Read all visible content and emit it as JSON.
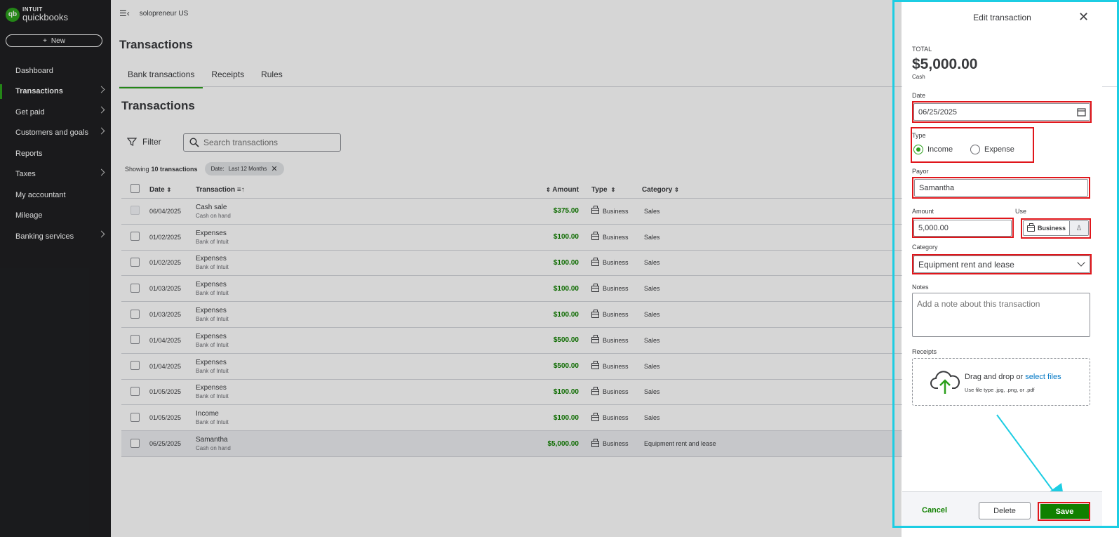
{
  "brand": {
    "mark": "qb",
    "line1": "INTUIT",
    "line2": "quickbooks"
  },
  "sidebar": {
    "new_label": "New",
    "items": [
      {
        "label": "Dashboard"
      },
      {
        "label": "Transactions"
      },
      {
        "label": "Get paid"
      },
      {
        "label": "Customers and goals"
      },
      {
        "label": "Reports"
      },
      {
        "label": "Taxes"
      },
      {
        "label": "My accountant"
      },
      {
        "label": "Mileage"
      },
      {
        "label": "Banking services"
      }
    ]
  },
  "header": {
    "company": "solopreneur US",
    "page_title": "Transactions"
  },
  "tabs": [
    "Bank transactions",
    "Receipts",
    "Rules"
  ],
  "section_title": "Transactions",
  "filter_label": "Filter",
  "search": {
    "placeholder": "Search transactions"
  },
  "showing": {
    "prefix": "Showing",
    "count": "10 transactions",
    "chip_label": "Date:",
    "chip_value": "Last 12 Months"
  },
  "table": {
    "columns": {
      "date": "Date",
      "transaction": "Transaction",
      "amount": "Amount",
      "type": "Type",
      "category": "Category"
    },
    "rows": [
      {
        "date": "06/04/2025",
        "name": "Cash sale",
        "account": "Cash on hand",
        "amount": "$375.00",
        "type": "Business",
        "category": "Sales"
      },
      {
        "date": "01/02/2025",
        "name": "Expenses",
        "account": "Bank of Intuit",
        "amount": "$100.00",
        "type": "Business",
        "category": "Sales"
      },
      {
        "date": "01/02/2025",
        "name": "Expenses",
        "account": "Bank of Intuit",
        "amount": "$100.00",
        "type": "Business",
        "category": "Sales"
      },
      {
        "date": "01/03/2025",
        "name": "Expenses",
        "account": "Bank of Intuit",
        "amount": "$100.00",
        "type": "Business",
        "category": "Sales"
      },
      {
        "date": "01/03/2025",
        "name": "Expenses",
        "account": "Bank of Intuit",
        "amount": "$100.00",
        "type": "Business",
        "category": "Sales"
      },
      {
        "date": "01/04/2025",
        "name": "Expenses",
        "account": "Bank of Intuit",
        "amount": "$500.00",
        "type": "Business",
        "category": "Sales"
      },
      {
        "date": "01/04/2025",
        "name": "Expenses",
        "account": "Bank of Intuit",
        "amount": "$500.00",
        "type": "Business",
        "category": "Sales"
      },
      {
        "date": "01/05/2025",
        "name": "Expenses",
        "account": "Bank of Intuit",
        "amount": "$100.00",
        "type": "Business",
        "category": "Sales"
      },
      {
        "date": "01/05/2025",
        "name": "Income",
        "account": "Bank of Intuit",
        "amount": "$100.00",
        "type": "Business",
        "category": "Sales"
      },
      {
        "date": "06/25/2025",
        "name": "Samantha",
        "account": "Cash on hand",
        "amount": "$5,000.00",
        "type": "Business",
        "category": "Equipment rent and lease"
      }
    ]
  },
  "drawer": {
    "title": "Edit transaction",
    "total_label": "TOTAL",
    "total_value": "$5,000.00",
    "total_account": "Cash",
    "date_label": "Date",
    "date_value": "06/25/2025",
    "type_label": "Type",
    "type_income": "Income",
    "type_expense": "Expense",
    "payor_label": "Payor",
    "payor_value": "Samantha",
    "amount_label": "Amount",
    "amount_value": "5,000.00",
    "use_label": "Use",
    "use_value": "Business",
    "category_label": "Category",
    "category_value": "Equipment rent and lease",
    "notes_label": "Notes",
    "notes_placeholder": "Add a note about this transaction",
    "receipts_label": "Receipts",
    "upload_text": "Drag and drop or",
    "upload_link": "select files",
    "upload_hint": "Use file type .jpg, .png, or .pdf",
    "cancel": "Cancel",
    "delete": "Delete",
    "save": "Save"
  },
  "colors": {
    "accent": "#2ca01c",
    "save": "#108000",
    "highlight_frame": "#1ccde3",
    "annotation": "#e0161b"
  }
}
